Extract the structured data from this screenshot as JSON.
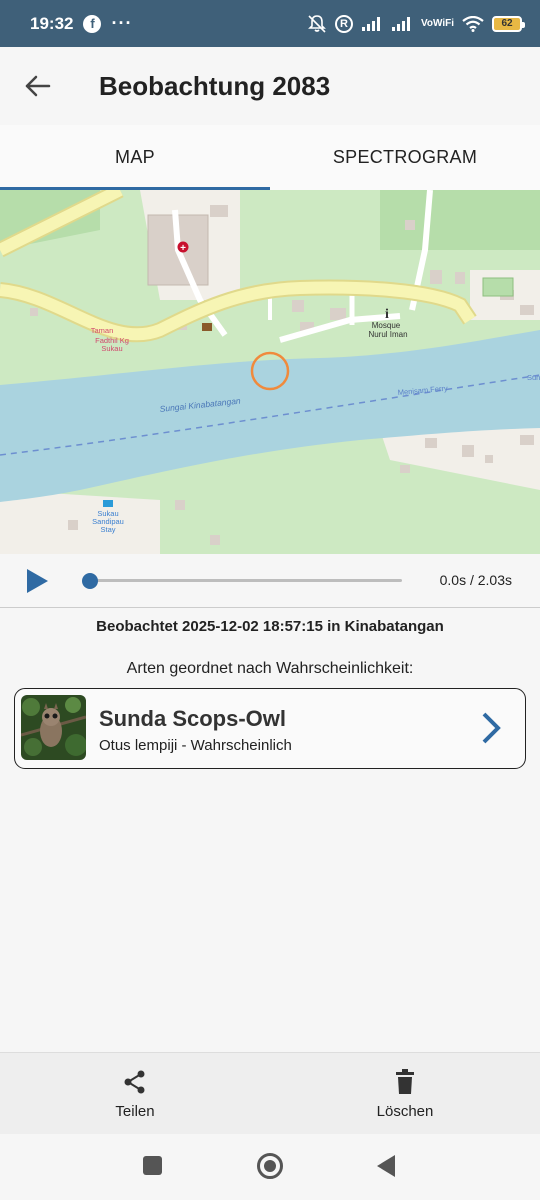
{
  "status_bar": {
    "time": "19:32",
    "fb_letter": "f",
    "more": "···",
    "r_label": "R",
    "volte_top": "Vo",
    "volte_bottom": "WiFi",
    "battery": "62"
  },
  "app_bar": {
    "title": "Beobachtung 2083"
  },
  "tabs": [
    {
      "label": "MAP",
      "active": true
    },
    {
      "label": "SPECTROGRAM",
      "active": false
    }
  ],
  "map": {
    "labels": {
      "taman_1": "Taman",
      "taman_2": "Fadthil Kg",
      "taman_3": "Sukau",
      "mosque_1": "Mosque",
      "mosque_2": "Nurul Iman",
      "river": "Sungai Kinabatangan",
      "ferry": "Menisam Ferry",
      "stay_1": "Sukau",
      "stay_2": "Sandipau",
      "stay_3": "Stay",
      "edge": "Sun"
    }
  },
  "player": {
    "time_display": "0.0s / 2.03s",
    "progress": 0
  },
  "observation": {
    "observed_text": "Beobachtet 2025-12-02 18:57:15 in Kinabatangan",
    "species_heading": "Arten geordnet nach Wahrscheinlichkeit:"
  },
  "species": [
    {
      "common_name": "Sunda Scops-Owl",
      "subtitle": "Otus lempiji - Wahrscheinlich"
    }
  ],
  "actions": {
    "share_label": "Teilen",
    "delete_label": "Löschen"
  },
  "colors": {
    "status_bar": "#3f6079",
    "accent": "#2f6aa3",
    "river": "#aad3df",
    "land": "#cde9c2",
    "road": "#f7f5b4",
    "marker": "#f08a3c"
  }
}
